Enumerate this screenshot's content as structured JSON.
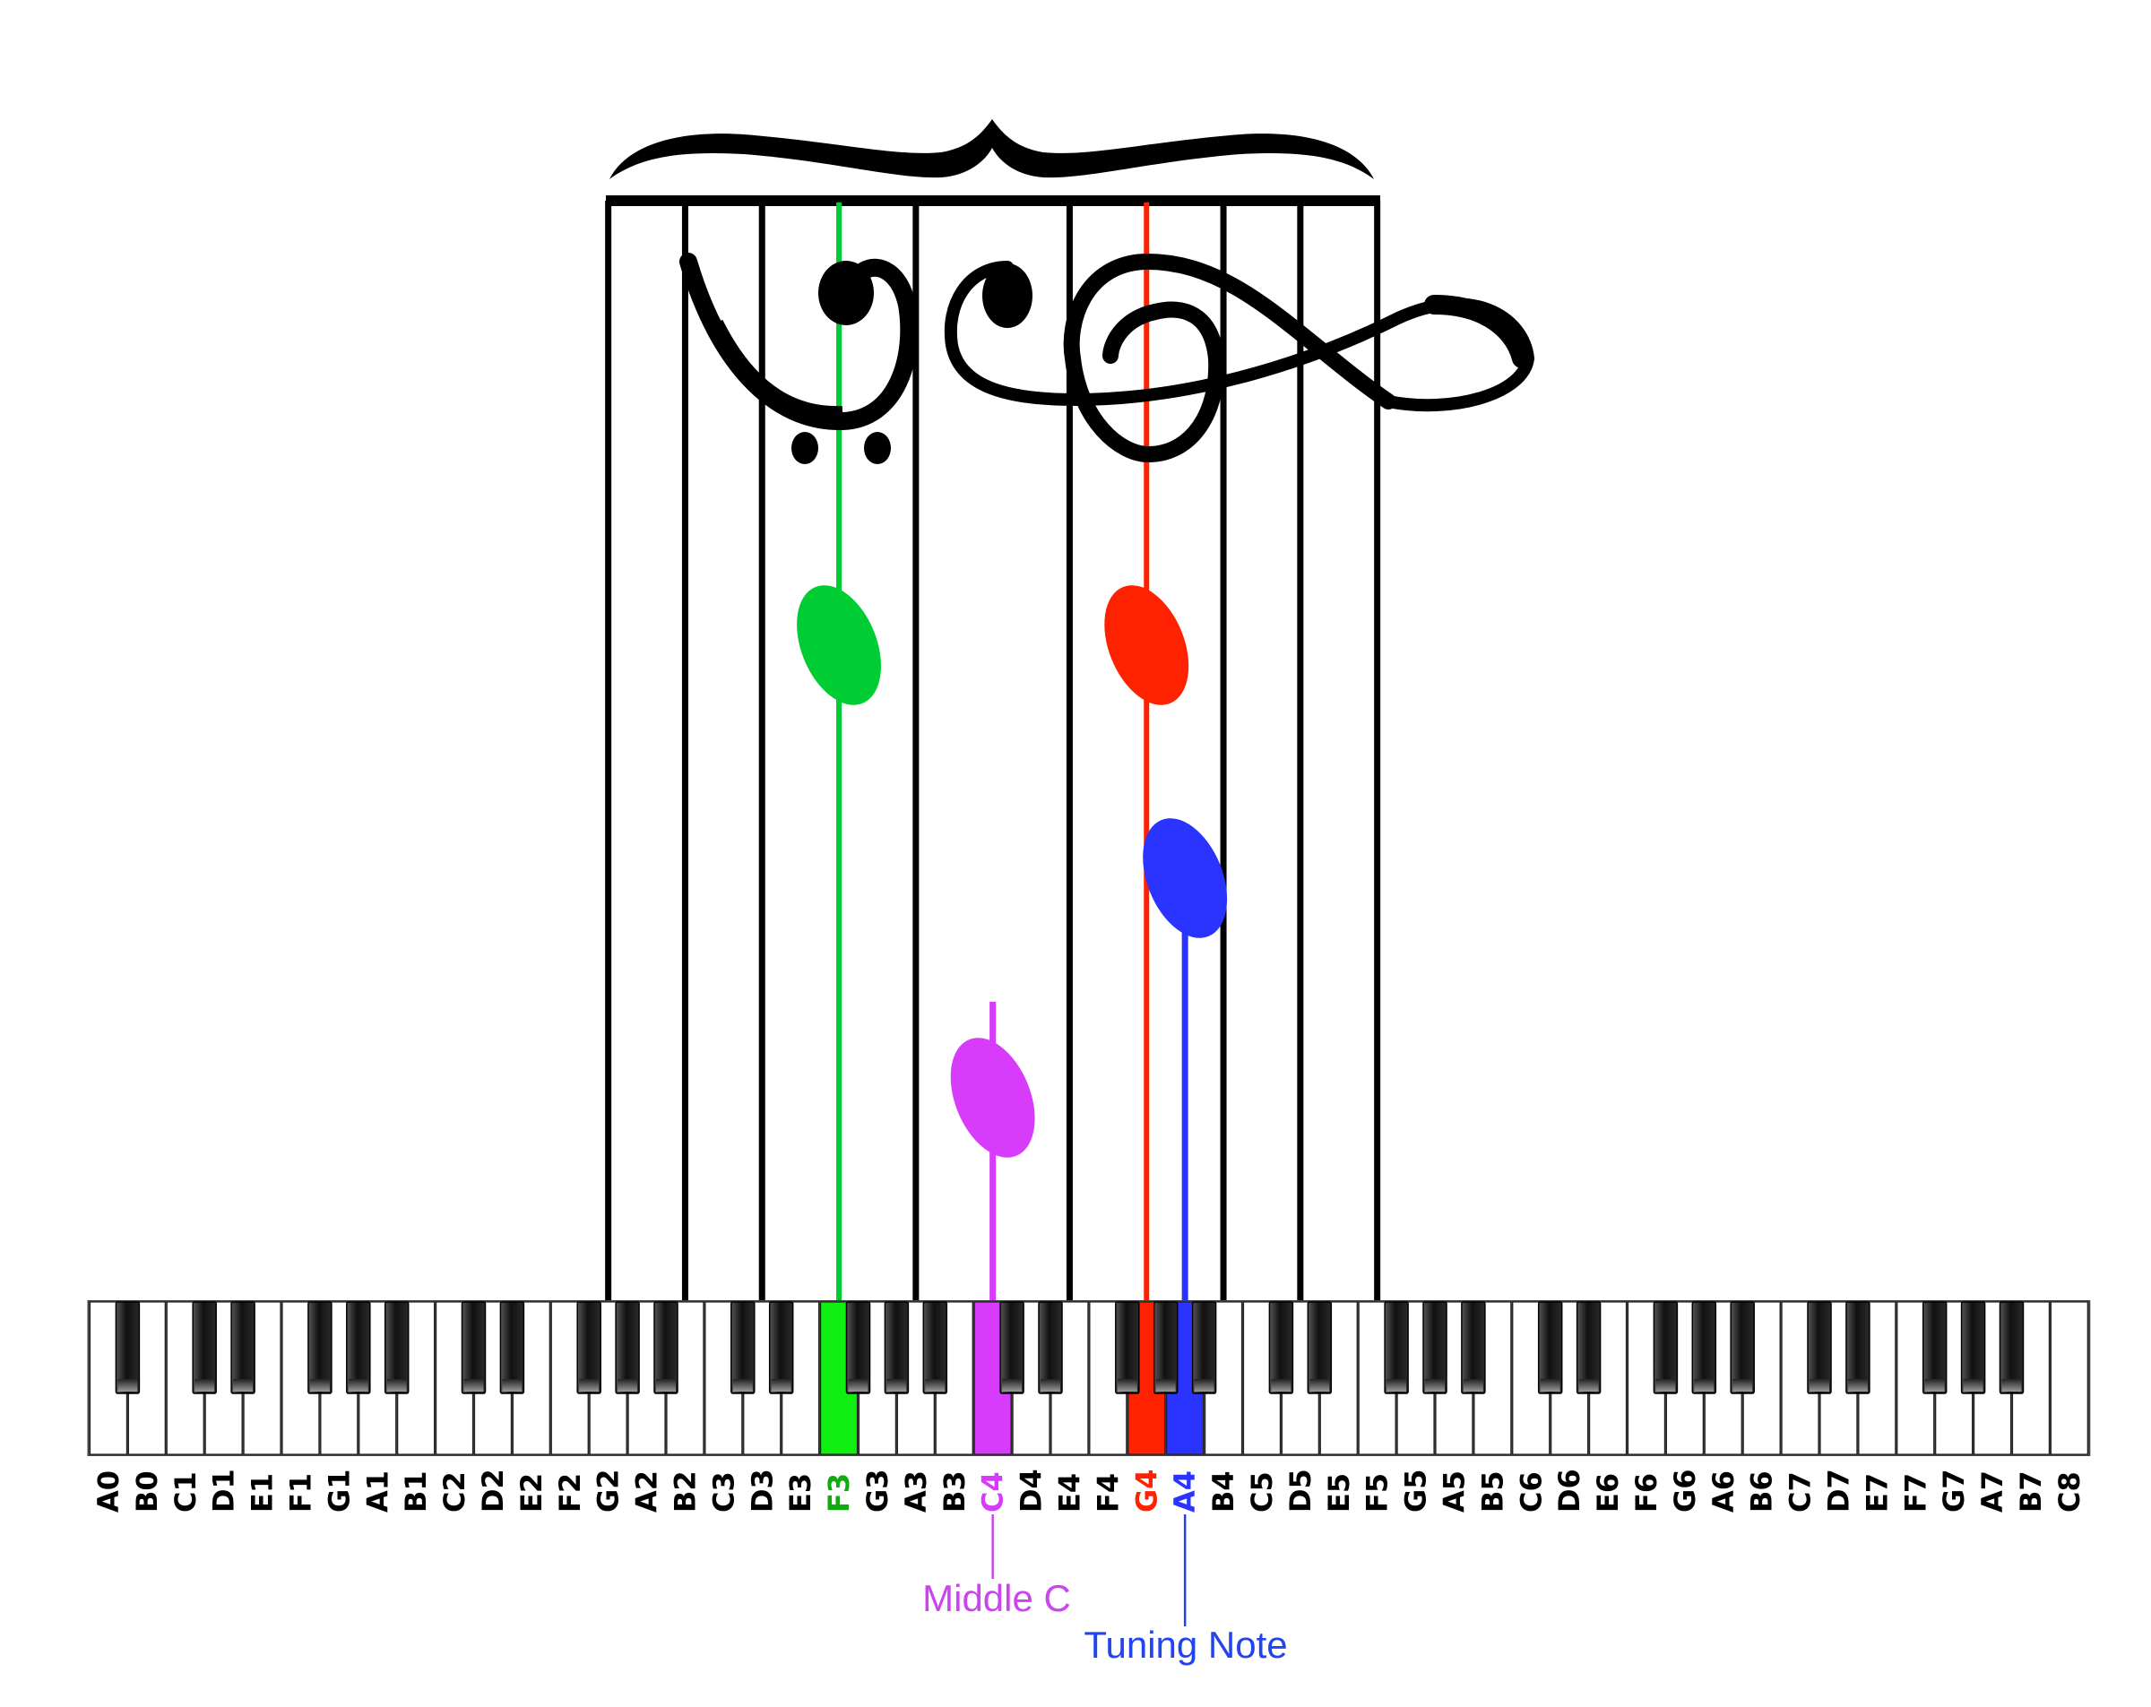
{
  "keyboard": {
    "white_keys": [
      "A0",
      "B0",
      "C1",
      "D1",
      "E1",
      "F1",
      "G1",
      "A1",
      "B1",
      "C2",
      "D2",
      "E2",
      "F2",
      "G2",
      "A2",
      "B2",
      "C3",
      "D3",
      "E3",
      "F3",
      "G3",
      "A3",
      "B3",
      "C4",
      "D4",
      "E4",
      "F4",
      "G4",
      "A4",
      "B4",
      "C5",
      "D5",
      "E5",
      "F5",
      "G5",
      "A5",
      "B5",
      "C6",
      "D6",
      "E6",
      "F6",
      "G6",
      "A6",
      "B6",
      "C7",
      "D7",
      "E7",
      "F7",
      "G7",
      "A7",
      "B7",
      "C8"
    ],
    "label_color": "#000000"
  },
  "staff": {
    "line_notes": [
      "G2",
      "B2",
      "D3",
      "F3",
      "A3",
      "E4",
      "G4",
      "B4",
      "D5",
      "F5"
    ],
    "line_color": "#000000",
    "clefs": [
      "bass-clef",
      "treble-clef"
    ],
    "brace": "brace"
  },
  "highlighted_notes": [
    {
      "note": "F3",
      "color": "#00cc33",
      "key_color": "#11ee11",
      "label_color": "#11aa11"
    },
    {
      "note": "C4",
      "color": "#d63cfa",
      "key_color": "#d63cfa",
      "label_color": "#d63cfa"
    },
    {
      "note": "G4",
      "color": "#ff2200",
      "key_color": "#ff2200",
      "label_color": "#ff2200"
    },
    {
      "note": "A4",
      "color": "#2b33ff",
      "key_color": "#2b33ff",
      "label_color": "#2b33ff"
    }
  ],
  "annotations": {
    "middle_c": {
      "text": "Middle C",
      "note": "C4",
      "color": "#cc44ee"
    },
    "tuning_note": {
      "text": "Tuning Note",
      "note": "A4",
      "color": "#2244ee"
    }
  }
}
